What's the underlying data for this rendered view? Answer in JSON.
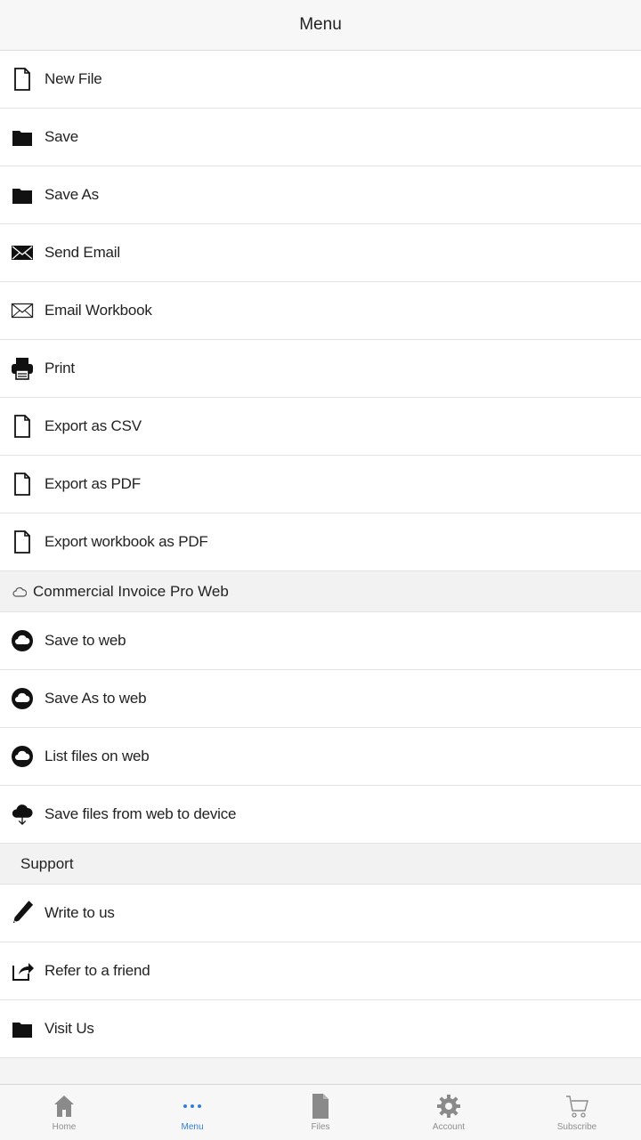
{
  "header": {
    "title": "Menu"
  },
  "file_items": [
    {
      "label": "New File",
      "icon": "document-icon"
    },
    {
      "label": "Save",
      "icon": "folder-icon"
    },
    {
      "label": "Save As",
      "icon": "folder-icon"
    },
    {
      "label": "Send Email",
      "icon": "envelope-filled-icon"
    },
    {
      "label": "Email Workbook",
      "icon": "envelope-outline-icon"
    },
    {
      "label": "Print",
      "icon": "printer-icon"
    },
    {
      "label": "Export as CSV",
      "icon": "document-icon"
    },
    {
      "label": "Export as PDF",
      "icon": "document-icon"
    },
    {
      "label": "Export workbook as PDF",
      "icon": "document-icon"
    }
  ],
  "web_section": {
    "title": "Commercial Invoice Pro Web",
    "icon": "cloud-outline-icon",
    "items": [
      {
        "label": "Save to web",
        "icon": "cloud-circle-icon"
      },
      {
        "label": "Save As to web",
        "icon": "cloud-circle-icon"
      },
      {
        "label": "List files on web",
        "icon": "cloud-circle-icon"
      },
      {
        "label": "Save files from web to device",
        "icon": "cloud-download-icon"
      }
    ]
  },
  "support_section": {
    "title": "Support",
    "items": [
      {
        "label": "Write to us",
        "icon": "pencil-icon"
      },
      {
        "label": "Refer to a friend",
        "icon": "share-icon"
      },
      {
        "label": "Visit Us",
        "icon": "folder-icon"
      }
    ]
  },
  "tabbar": {
    "active_color": "#2f7de1",
    "tabs": [
      {
        "label": "Home",
        "icon": "home-icon"
      },
      {
        "label": "Menu",
        "icon": "more-dots-icon"
      },
      {
        "label": "Files",
        "icon": "file-icon"
      },
      {
        "label": "Account",
        "icon": "gear-icon"
      },
      {
        "label": "Subscribe",
        "icon": "cart-icon"
      }
    ]
  }
}
